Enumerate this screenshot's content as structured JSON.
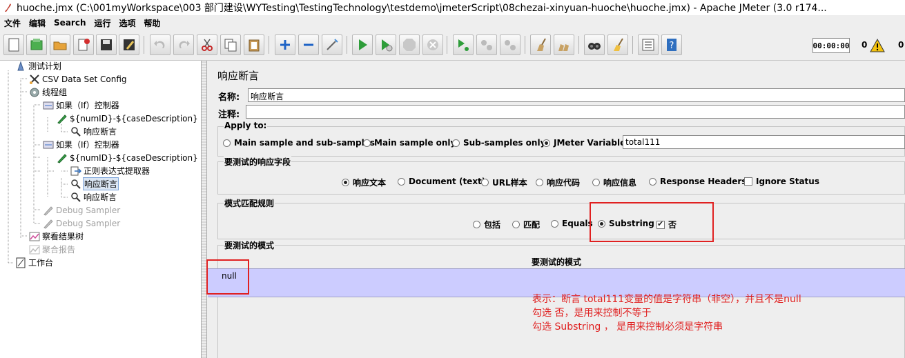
{
  "window": {
    "title": "huoche.jmx (C:\\001myWorkspace\\003 部门建设\\WYTesting\\TestingTechnology\\testdemo\\jmeterScript\\08chezai-xinyuan-huoche\\huoche.jmx) - Apache JMeter (3.0 r174..."
  },
  "menu": [
    "文件",
    "编辑",
    "Search",
    "运行",
    "选项",
    "帮助"
  ],
  "toolbar": {
    "timer": "00:00:00",
    "error_count": "0",
    "thread_count": "0"
  },
  "tree": [
    {
      "label": "测试计划",
      "icon": "test-plan-icon"
    },
    {
      "label": "CSV Data Set Config",
      "icon": "scissors-icon"
    },
    {
      "label": "线程组",
      "icon": "gear-icon"
    },
    {
      "label": "如果（If）控制器",
      "icon": "if-controller-icon"
    },
    {
      "label": "${numID}-${caseDescription}",
      "icon": "sampler-pen-icon"
    },
    {
      "label": "响应断言",
      "icon": "magnifier-icon"
    },
    {
      "label": "如果（If）控制器",
      "icon": "if-controller-icon"
    },
    {
      "label": "${numID}-${caseDescription}",
      "icon": "sampler-pen-icon"
    },
    {
      "label": "正则表达式提取器",
      "icon": "extractor-arrow-icon"
    },
    {
      "label": "响应断言",
      "icon": "magnifier-icon"
    },
    {
      "label": "响应断言",
      "icon": "magnifier-icon"
    },
    {
      "label": "Debug Sampler",
      "icon": "pen-icon"
    },
    {
      "label": "Debug Sampler",
      "icon": "pen-icon"
    },
    {
      "label": "察看结果树",
      "icon": "chart-icon"
    },
    {
      "label": "聚合报告",
      "icon": "chart-icon"
    },
    {
      "label": "工作台",
      "icon": "workbench-icon"
    }
  ],
  "panel": {
    "title": "响应断言",
    "name_label": "名称:",
    "name_value": "响应断言",
    "comment_label": "注释:",
    "comment_value": "",
    "apply_to": {
      "title": "Apply to:",
      "options": [
        "Main sample and sub-samples",
        "Main sample only",
        "Sub-samples only",
        "JMeter Variable"
      ],
      "selected": "JMeter Variable",
      "variable_value": "total111"
    },
    "response_field": {
      "title": "要测试的响应字段",
      "options": [
        "响应文本",
        "Document (text)",
        "URL样本",
        "响应代码",
        "响应信息",
        "Response Headers"
      ],
      "selected": "响应文本",
      "ignore_status_label": "Ignore Status",
      "ignore_status_checked": false
    },
    "matching_rules": {
      "title": "模式匹配规则",
      "options": [
        "包括",
        "匹配",
        "Equals",
        "Substring"
      ],
      "selected": "Substring",
      "not_label": "否",
      "not_checked": true
    },
    "patterns": {
      "title": "要测试的模式",
      "column_header": "要测试的模式",
      "rows": [
        "null"
      ]
    }
  },
  "annotation": {
    "line1": "表示：断言 total111变量的值是字符串（非空），并且不是null",
    "line2": "勾选 否，是用来控制不等于",
    "line3": "勾选 Substring ， 是用来控制必须是字符串"
  }
}
